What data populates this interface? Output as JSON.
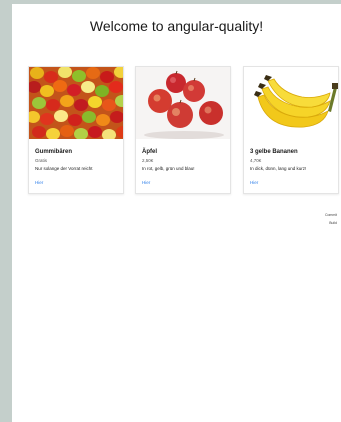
{
  "header": {
    "title": "Welcome to angular-quality!"
  },
  "products": [
    {
      "name": "Gummibären",
      "price": "Gratis",
      "description": "Nur solange der Vorrat reicht",
      "link_label": "Hier",
      "image_icon": "gummy-bears-image"
    },
    {
      "name": "Äpfel",
      "price": "2,50€",
      "description": "In rot, gelb, grün und blau!",
      "link_label": "Hier",
      "image_icon": "apples-image"
    },
    {
      "name": "3 gelbe Bananen",
      "price": "4,70€",
      "description": "In dick, dünn, lang und kurz!",
      "link_label": "Hier",
      "image_icon": "bananas-image"
    }
  ],
  "footer": {
    "commit_label": "Commit",
    "build_label": "Build"
  },
  "colors": {
    "link": "#2b7de9",
    "background": "#c4cfcb"
  }
}
